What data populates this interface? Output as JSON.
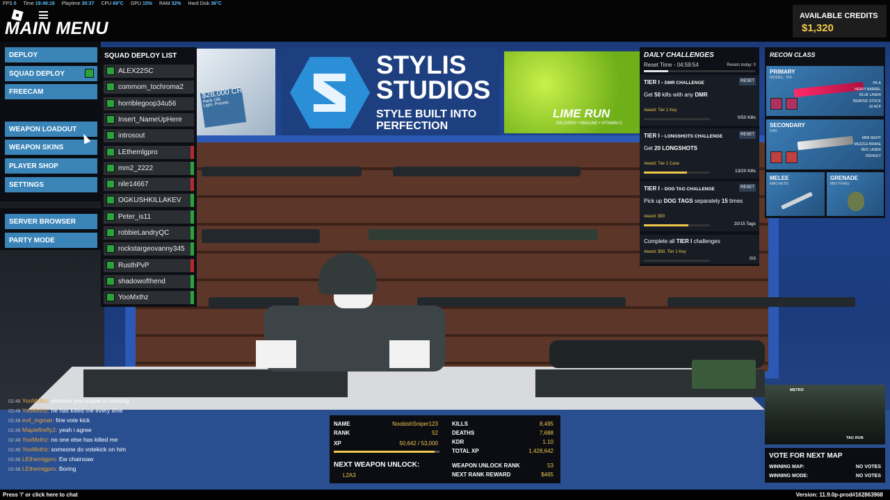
{
  "hud_stats": [
    {
      "label": "FPS",
      "value": "0"
    },
    {
      "label": "Time",
      "value": "19:49:16"
    },
    {
      "label": "Playtime",
      "value": "30:37"
    },
    {
      "label": "CPU",
      "value": "69°C"
    },
    {
      "label": "GPU",
      "value": "15%"
    },
    {
      "label": "RAM",
      "value": "32%"
    },
    {
      "label": "Hard Disk",
      "value": "36°C"
    }
  ],
  "header": {
    "title": "MAIN MENU"
  },
  "credits": {
    "label": "AVAILABLE CREDITS",
    "value": "$1,320"
  },
  "menu": {
    "deploy": "DEPLOY",
    "squad_deploy": "SQUAD DEPLOY",
    "freecam": "FREECAM",
    "weapon_loadout": "WEAPON LOADOUT",
    "weapon_skins": "WEAPON SKINS",
    "player_shop": "PLAYER SHOP",
    "settings": "SETTINGS",
    "server_browser": "SERVER BROWSER",
    "party_mode": "PARTY MODE"
  },
  "squad": {
    "title": "SQUAD DEPLOY LIST",
    "players": [
      {
        "name": "ALEX22SC",
        "status": "#2b2f33"
      },
      {
        "name": "commom_tochroma2",
        "status": "#2b2f33"
      },
      {
        "name": "horriblegoop34u56",
        "status": "#2b2f33"
      },
      {
        "name": "Insert_NameUpHere",
        "status": "#2b2f33"
      },
      {
        "name": "introsout",
        "status": "#2b2f33"
      },
      {
        "name": "LEthemlgpro",
        "status": "#b52a2a"
      },
      {
        "name": "mm2_2222",
        "status": "#2aa33c"
      },
      {
        "name": "nile14667",
        "status": "#b52a2a"
      },
      {
        "name": "OGKUSHKILLAKEV",
        "status": "#2aa33c"
      },
      {
        "name": "Peter_is11",
        "status": "#2aa33c"
      },
      {
        "name": "robbieLandryQC",
        "status": "#2aa33c"
      },
      {
        "name": "rockstargeovanny345",
        "status": "#2aa33c"
      },
      {
        "name": "RusthPvP",
        "status": "#b52a2a"
      },
      {
        "name": "shadowofthend",
        "status": "#2aa33c"
      },
      {
        "name": "YooMxthz",
        "status": "#2aa33c"
      }
    ]
  },
  "banners": {
    "card_price": "$28,000 CR",
    "card_rank": "Rank 195",
    "card_slogan": "Light. Precise.",
    "studio_line1": "STYLIS",
    "studio_line2": "STUDIOS",
    "studio_line3": "STYLE BUILT INTO",
    "studio_line4": "PERFECTION",
    "lime_title": "LIME RUN",
    "lime_sub": "DELIVERY • MAILING • VITAMIN C"
  },
  "daily": {
    "title": "DAILY CHALLENGES",
    "reset_time": "Reset Time - 04:59:54",
    "resets_today": "Resets today: 0",
    "reset_label": "RESET",
    "challenges": [
      {
        "tier": "TIER I",
        "name": "DMR CHALLENGE",
        "desc_pre": "Get ",
        "desc_num": "50",
        "desc_mid": " kills with any ",
        "desc_bold": "DMR",
        "award": "Award: Tier 1 Key",
        "count": "0/50 Kills",
        "progress": 0
      },
      {
        "tier": "TIER I",
        "name": "LONGSHOTS CHALLENGE",
        "desc_pre": "Get ",
        "desc_num": "20",
        "desc_mid": " ",
        "desc_bold": "LONGSHOTS",
        "award": "Award: Tier 1 Case",
        "count": "13/20 Kills",
        "progress": 0.65
      },
      {
        "tier": "TIER I",
        "name": "DOG TAG CHALLENGE",
        "desc_pre": "Pick up ",
        "desc_num": "DOG TAGS",
        "desc_mid": " separately ",
        "desc_bold": "15",
        "desc_post": " times",
        "award": "Award: $50",
        "count": "10/15 Tags",
        "progress": 0.67
      }
    ],
    "final": {
      "text_pre": "Complete all ",
      "text_bold": "TIER I",
      "text_post": " challenges",
      "award": "Award: $50, Tier 1 Key",
      "count": "0/3",
      "progress": 0
    }
  },
  "recon": {
    "title": "RECON CLASS",
    "primary": {
      "label": "PRIMARY",
      "model": "MODEL: 700",
      "attachments": [
        "PK-A",
        "HEAVY BARREL",
        "BLUE LASER",
        "REMOVE STOCK",
        ".32 ACP"
      ]
    },
    "secondary": {
      "label": "SECONDARY",
      "model": "G40",
      "attachments": [
        "MINI SIGHT",
        "MUZZLE BRAKE",
        "RED LASER",
        "DEFAULT"
      ]
    },
    "melee": {
      "label": "MELEE",
      "model": "MACHETE"
    },
    "grenade": {
      "label": "GRENADE",
      "model": "M67 FRAG"
    }
  },
  "map": {
    "top_label": "METRO",
    "bottom_label": "TAG RUN"
  },
  "vote": {
    "title": "VOTE FOR NEXT MAP",
    "winning_map_label": "WINNING MAP:",
    "winning_map_value": "NO VOTES",
    "winning_mode_label": "WINNING MODE:",
    "winning_mode_value": "NO VOTES"
  },
  "player": {
    "name_label": "NAME",
    "name": "NoobishSniper123",
    "rank_label": "RANK",
    "rank": "52",
    "xp_label": "XP",
    "xp": "50,642 / 53,000",
    "xp_progress": 0.955,
    "kills_label": "KILLS",
    "kills": "8,495",
    "deaths_label": "DEATHS",
    "deaths": "7,688",
    "kdr_label": "KDR",
    "kdr": "1.10",
    "total_xp_label": "TOTAL XP",
    "total_xp": "1,428,642",
    "next_unlock_label": "NEXT WEAPON UNLOCK:",
    "next_unlock": "L2A3",
    "unlock_rank_label": "WEAPON UNLOCK RANK",
    "unlock_rank": "53",
    "next_reward_label": "NEXT RANK REWARD",
    "next_reward": "$465"
  },
  "chat": [
    {
      "time": "02:48",
      "name": "YooMxthz:",
      "msg": "promise you maple is hacking"
    },
    {
      "time": "02:48",
      "name": "YooMxthz:",
      "msg": "he has killed me every time"
    },
    {
      "time": "02:48",
      "name": "evil_ingmar:",
      "msg": "fine vote kick"
    },
    {
      "time": "02:48",
      "name": "Maplefirefly2:",
      "msg": "yeah i agree"
    },
    {
      "time": "02:48",
      "name": "YooMxthz:",
      "msg": "no one else has killed me"
    },
    {
      "time": "02:48",
      "name": "YooMxthz:",
      "msg": "someone do votekick on him"
    },
    {
      "time": "02:48",
      "name": "LEthemlgpro:",
      "msg": "Ew chainsaw"
    },
    {
      "time": "02:48",
      "name": "LEthemlgpro:",
      "msg": "Boring"
    }
  ],
  "footer": {
    "chat_hint": "Press '/' or click here to chat",
    "version": "Version: 11.9.0p-prod#162863968"
  }
}
